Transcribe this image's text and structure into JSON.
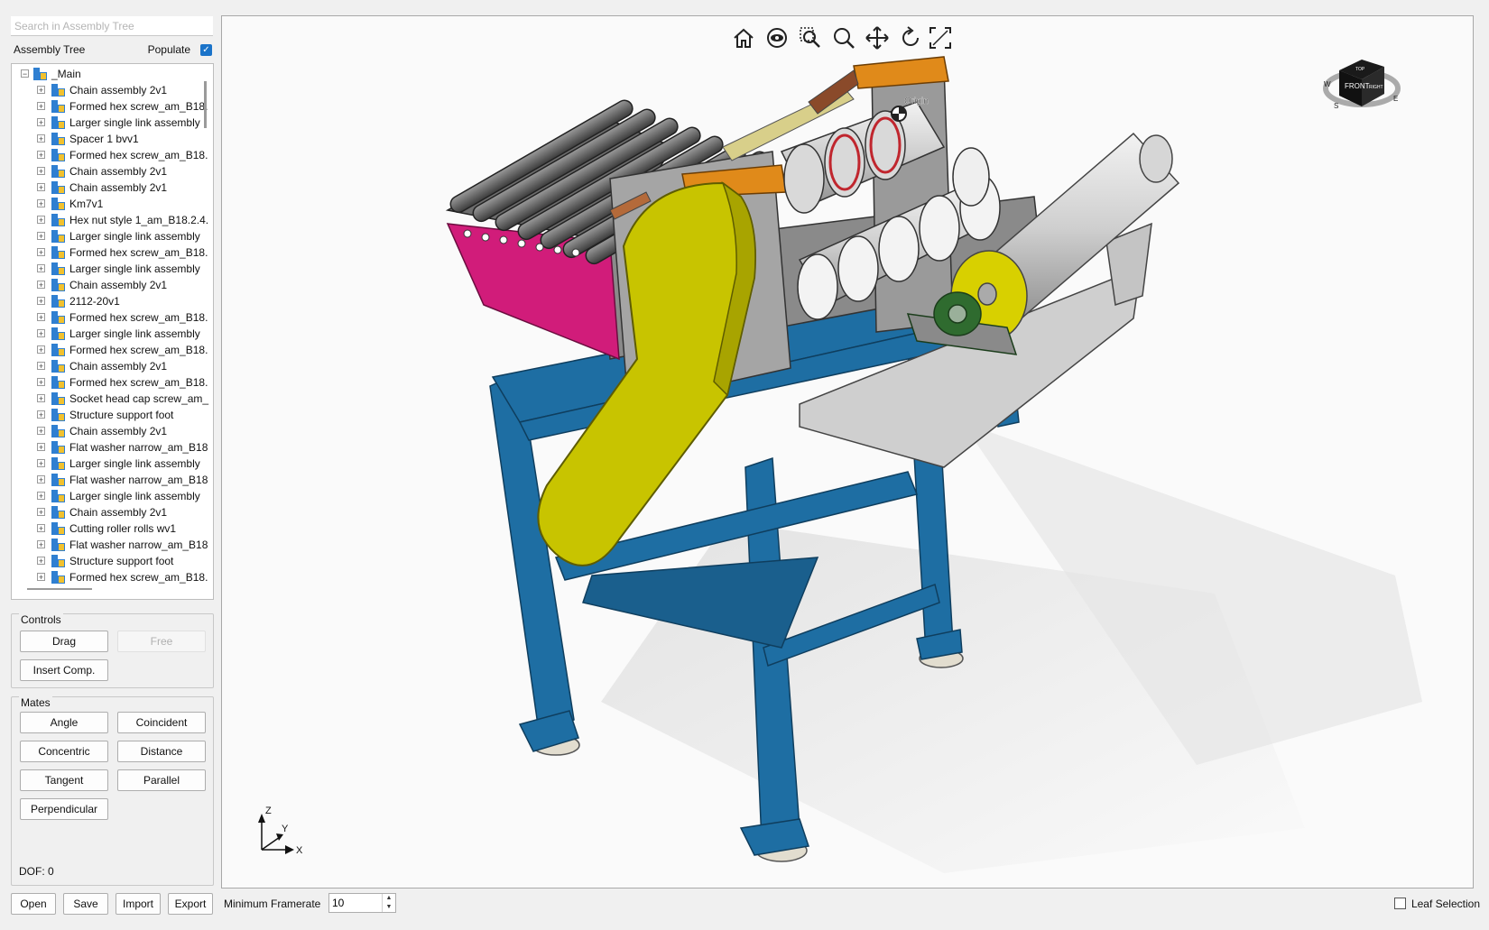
{
  "search": {
    "placeholder": "Search in Assembly Tree"
  },
  "assembly_tree": {
    "title": "Assembly Tree",
    "populate_label": "Populate",
    "populate_checked": true,
    "root": "_Main",
    "items": [
      "Chain assembly 2v1",
      "Formed hex screw_am_B18.",
      "Larger single link assembly",
      "Spacer 1 bvv1",
      "Formed hex screw_am_B18.",
      "Chain assembly 2v1",
      "Chain assembly 2v1",
      "Km7v1",
      "Hex nut style 1_am_B18.2.4.",
      "Larger single link assembly",
      "Formed hex screw_am_B18.",
      "Larger single link assembly",
      "Chain assembly 2v1",
      "2112-20v1",
      "Formed hex screw_am_B18.",
      "Larger single link assembly",
      "Formed hex screw_am_B18.",
      "Chain assembly 2v1",
      "Formed hex screw_am_B18.",
      "Socket head cap screw_am_",
      "Structure support foot",
      "Chain assembly 2v1",
      "Flat washer narrow_am_B18",
      "Larger single link assembly",
      "Flat washer narrow_am_B18",
      "Larger single link assembly",
      "Chain assembly 2v1",
      "Cutting roller rolls wv1",
      "Flat washer narrow_am_B18",
      "Structure support foot",
      "Formed hex screw_am_B18."
    ]
  },
  "controls": {
    "title": "Controls",
    "drag": "Drag",
    "free": "Free",
    "insert": "Insert Comp."
  },
  "mates": {
    "title": "Mates",
    "angle": "Angle",
    "coincident": "Coincident",
    "concentric": "Concentric",
    "distance": "Distance",
    "tangent": "Tangent",
    "parallel": "Parallel",
    "perpendicular": "Perpendicular"
  },
  "dof": "DOF: 0",
  "bottom": {
    "open": "Open",
    "save": "Save",
    "import": "Import",
    "export": "Export",
    "framerate_label": "Minimum Framerate",
    "framerate_value": "10",
    "leaf_selection": "Leaf Selection"
  },
  "viewport": {
    "origin_label": "Origin",
    "axis_labels": {
      "z": "Z",
      "y": "Y",
      "x": "X"
    },
    "cube_labels": {
      "top": "TOP",
      "front": "FRONT",
      "right": "RIGHT",
      "w": "W",
      "s": "S",
      "e": "E"
    },
    "colors": {
      "frame": "#1e6ea3",
      "guard": "#c8c400",
      "chute": "#d11c7a",
      "roller_body": "#c9c9c9",
      "brackets": "#e08a1a",
      "bearing": "#2f6b2f"
    }
  },
  "toolbar_icons": [
    "home-icon",
    "view-orbit-icon",
    "zoom-box-icon",
    "zoom-icon",
    "pan-icon",
    "rotate-icon",
    "fit-all-icon"
  ]
}
